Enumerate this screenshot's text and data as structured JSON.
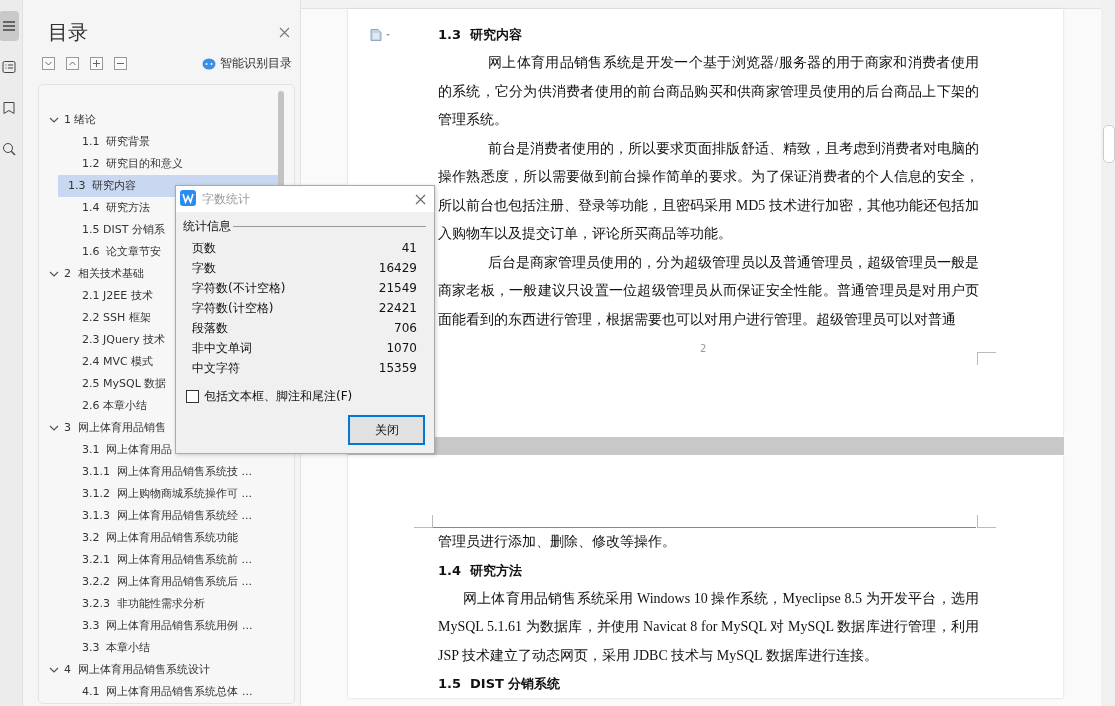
{
  "side_strip": [
    {
      "kind": "outline",
      "selected": true
    },
    {
      "kind": "list",
      "selected": false
    },
    {
      "kind": "bookmark",
      "selected": false
    },
    {
      "kind": "find",
      "selected": false
    }
  ],
  "toc_panel": {
    "title": "目录",
    "tools": [
      {
        "kind": "collapse"
      },
      {
        "kind": "expand"
      },
      {
        "kind": "add"
      },
      {
        "kind": "remove"
      }
    ],
    "smart_button": "智能识别目录",
    "items": [
      {
        "label": "1 绪论",
        "expanded": true,
        "selected": false,
        "children": [
          {
            "label": "1.1  研究背景",
            "selected": false
          },
          {
            "label": "1.2  研究目的和意义",
            "selected": false
          },
          {
            "label": "1.3  研究内容",
            "selected": true
          },
          {
            "label": "1.4  研究方法",
            "selected": false
          },
          {
            "label": "1.5 DIST 分销系",
            "selected": false
          },
          {
            "label": "1.6  论文章节安",
            "selected": false
          }
        ]
      },
      {
        "label": "2  相关技术基础",
        "expanded": true,
        "selected": false,
        "children": [
          {
            "label": "2.1 J2EE 技术",
            "selected": false
          },
          {
            "label": "2.2 SSH 框架",
            "selected": false
          },
          {
            "label": "2.3 JQuery 技术",
            "selected": false
          },
          {
            "label": "2.4 MVC 模式",
            "selected": false
          },
          {
            "label": "2.5 MySQL 数据",
            "selected": false
          },
          {
            "label": "2.6 本章小结",
            "selected": false
          }
        ]
      },
      {
        "label": "3  网上体育用品销售",
        "expanded": true,
        "selected": false,
        "children": [
          {
            "label": "3.1  网上体育用品",
            "selected": false
          },
          {
            "label": "3.1.1  网上体育用品销售系统技 ...",
            "selected": false
          },
          {
            "label": "3.1.2  网上购物商城系统操作可 ...",
            "selected": false
          },
          {
            "label": "3.1.3  网上体育用品销售系统经 ...",
            "selected": false
          },
          {
            "label": "3.2  网上体育用品销售系统功能",
            "selected": false
          },
          {
            "label": "3.2.1  网上体育用品销售系统前 ...",
            "selected": false
          },
          {
            "label": "3.2.2  网上体育用品销售系统后 ...",
            "selected": false
          },
          {
            "label": "3.2.3  非功能性需求分析",
            "selected": false
          },
          {
            "label": "3.3  网上体育用品销售系统用例 ...",
            "selected": false
          },
          {
            "label": "3.3  本章小结",
            "selected": false
          }
        ]
      },
      {
        "label": "4  网上体育用品销售系统设计",
        "expanded": true,
        "selected": false,
        "children": [
          {
            "label": "4.1  网上体育用品销售系统总体 ...",
            "selected": false
          }
        ]
      }
    ]
  },
  "document": {
    "pages": [
      {
        "page_number": "2",
        "blocks": [
          {
            "kind": "heading",
            "text": "1.3  研究内容"
          },
          {
            "kind": "para",
            "text": "网上体育用品销售系统是开发一个基于浏览器/服务器的用于商家和消费者使用的系统，它分为供消费者使用的前台商品购买和供商家管理员使用的后台商品上下架的管理系统。"
          },
          {
            "kind": "para",
            "text": "前台是消费者使用的，所以要求页面排版舒适、精致，且考虑到消费者对电脑的操作熟悉度，所以需要做到前台操作简单的要求。为了保证消费者的个人信息的安全，所以前台也包括注册、登录等功能，且密码采用 MD5 技术进行加密，其他功能还包括加入购物车以及提交订单，评论所买商品等功能。"
          },
          {
            "kind": "para",
            "text": "后台是商家管理员使用的，分为超级管理员以及普通管理员，超级管理员一般是商家老板，一般建议只设置一位超级管理员从而保证安全性能。普通管理员是对用户页面能看到的东西进行管理，根据需要也可以对用户进行管理。超级管理员可以对普通"
          }
        ]
      },
      {
        "blocks": [
          {
            "kind": "continued",
            "text": "管理员进行添加、删除、修改等操作。"
          },
          {
            "kind": "heading",
            "text": "1.4  研究方法"
          },
          {
            "kind": "para_short",
            "text": "网上体育用品销售系统采用 Windows 10 操作系统，Myeclipse 8.5 为开发平台，选用 MySQL 5.1.61 为数据库，并使用 Navicat 8 for MySQL 对 MySQL 数据库进行管理，利用 JSP 技术建立了动态网页，采用 JDBC 技术与 MySQL 数据库进行连接。"
          },
          {
            "kind": "heading",
            "text": "1.5  DIST 分销系统"
          }
        ]
      }
    ]
  },
  "dialog": {
    "title": "字数统计",
    "group": "统计信息",
    "stats": [
      {
        "label": "页数",
        "value": "41"
      },
      {
        "label": "字数",
        "value": "16429"
      },
      {
        "label": "字符数(不计空格)",
        "value": "21549"
      },
      {
        "label": "字符数(计空格)",
        "value": "22421"
      },
      {
        "label": "段落数",
        "value": "706"
      },
      {
        "label": "非中文单词",
        "value": "1070"
      },
      {
        "label": "中文字符",
        "value": "15359"
      }
    ],
    "checkbox": {
      "label": "包括文本框、脚注和尾注(F)",
      "checked": false
    },
    "button": "关闭"
  }
}
